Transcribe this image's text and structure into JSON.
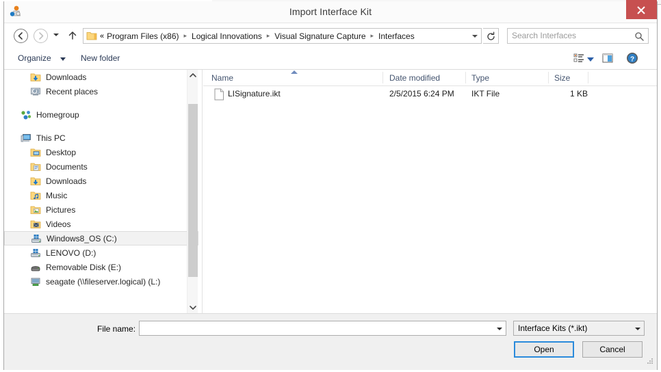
{
  "window": {
    "title": "Import Interface Kit",
    "app_icon": "app-icon",
    "close_label": "Close"
  },
  "nav": {
    "back_tooltip": "Back",
    "forward_tooltip": "Forward",
    "recent_tooltip": "Recent locations",
    "up_tooltip": "Up one level",
    "refresh_tooltip": "Refresh",
    "address_prefix": "«",
    "breadcrumbs": [
      "Program Files (x86)",
      "Logical Innovations",
      "Visual Signature Capture",
      "Interfaces"
    ],
    "separator": "▸"
  },
  "search": {
    "placeholder": "Search Interfaces",
    "value": ""
  },
  "toolbar": {
    "organize_label": "Organize",
    "new_folder_label": "New folder",
    "views_tooltip": "Change your view",
    "preview_pane_tooltip": "Show the preview pane",
    "help_tooltip": "Get help"
  },
  "navpane": {
    "items": [
      {
        "label": "Downloads",
        "icon": "folder-download-icon",
        "indent": 1,
        "selected": false,
        "gap_before": false
      },
      {
        "label": "Recent places",
        "icon": "recent-places-icon",
        "indent": 1,
        "selected": false,
        "gap_before": false
      },
      {
        "label": "Homegroup",
        "icon": "homegroup-icon",
        "indent": 0,
        "selected": false,
        "gap_before": true
      },
      {
        "label": "This PC",
        "icon": "this-pc-icon",
        "indent": 0,
        "selected": false,
        "gap_before": true
      },
      {
        "label": "Desktop",
        "icon": "desktop-icon",
        "indent": 1,
        "selected": false,
        "gap_before": false
      },
      {
        "label": "Documents",
        "icon": "documents-icon",
        "indent": 1,
        "selected": false,
        "gap_before": false
      },
      {
        "label": "Downloads",
        "icon": "folder-download-icon",
        "indent": 1,
        "selected": false,
        "gap_before": false
      },
      {
        "label": "Music",
        "icon": "music-icon",
        "indent": 1,
        "selected": false,
        "gap_before": false
      },
      {
        "label": "Pictures",
        "icon": "pictures-icon",
        "indent": 1,
        "selected": false,
        "gap_before": false
      },
      {
        "label": "Videos",
        "icon": "videos-icon",
        "indent": 1,
        "selected": false,
        "gap_before": false
      },
      {
        "label": "Windows8_OS (C:)",
        "icon": "local-disk-icon",
        "indent": 1,
        "selected": true,
        "gap_before": false
      },
      {
        "label": "LENOVO (D:)",
        "icon": "local-disk-icon",
        "indent": 1,
        "selected": false,
        "gap_before": false
      },
      {
        "label": "Removable Disk (E:)",
        "icon": "removable-disk-icon",
        "indent": 1,
        "selected": false,
        "gap_before": false
      },
      {
        "label": "seagate (\\\\fileserver.logical) (L:)",
        "icon": "network-drive-icon",
        "indent": 1,
        "selected": false,
        "gap_before": false
      }
    ]
  },
  "filelist": {
    "columns": [
      {
        "label": "Name",
        "sorted": true
      },
      {
        "label": "Date modified",
        "sorted": false
      },
      {
        "label": "Type",
        "sorted": false
      },
      {
        "label": "Size",
        "sorted": false
      }
    ],
    "sort_direction": "ascending",
    "rows": [
      {
        "icon": "file-icon",
        "name": "LISignature.ikt",
        "date_modified": "2/5/2015 6:24 PM",
        "type": "IKT File",
        "size": "1 KB"
      }
    ]
  },
  "footer": {
    "file_name_label": "File name:",
    "file_name_value": "",
    "filter_value": "Interface Kits (*.ikt)",
    "open_label": "Open",
    "cancel_label": "Cancel"
  },
  "colors": {
    "close_button": "#c75050",
    "default_button_focus": "#2a8adb",
    "column_header_text": "#44546f",
    "toolbar_text": "#2b3a56",
    "panel_background": "#f0f0f0"
  }
}
